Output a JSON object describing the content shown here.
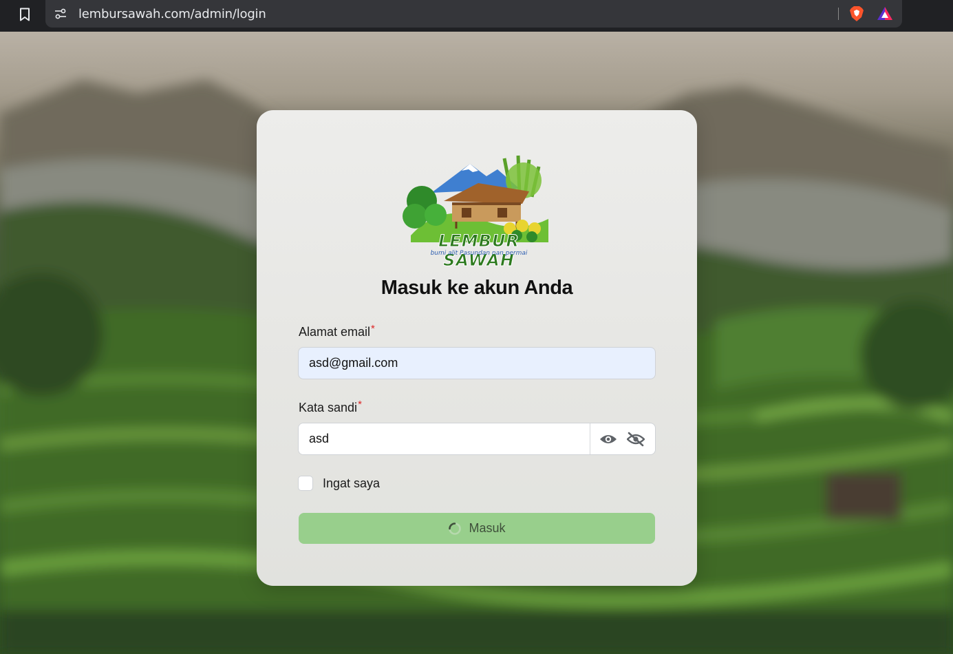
{
  "browser": {
    "url": "lembursawah.com/admin/login"
  },
  "logo": {
    "brand": "LEMBUR SAWAH",
    "tagline": "bumi alit Pasundan nan permai"
  },
  "login": {
    "heading": "Masuk ke akun Anda",
    "email_label": "Alamat email",
    "email_value": "asd@gmail.com",
    "password_label": "Kata sandi",
    "password_value": "asd",
    "required_mark": "*",
    "remember_label": "Ingat saya",
    "submit_label": "Masuk"
  },
  "colors": {
    "submit_button": "#98cf8c",
    "email_autofill_bg": "#e8f0fe",
    "required": "#dc2626"
  }
}
